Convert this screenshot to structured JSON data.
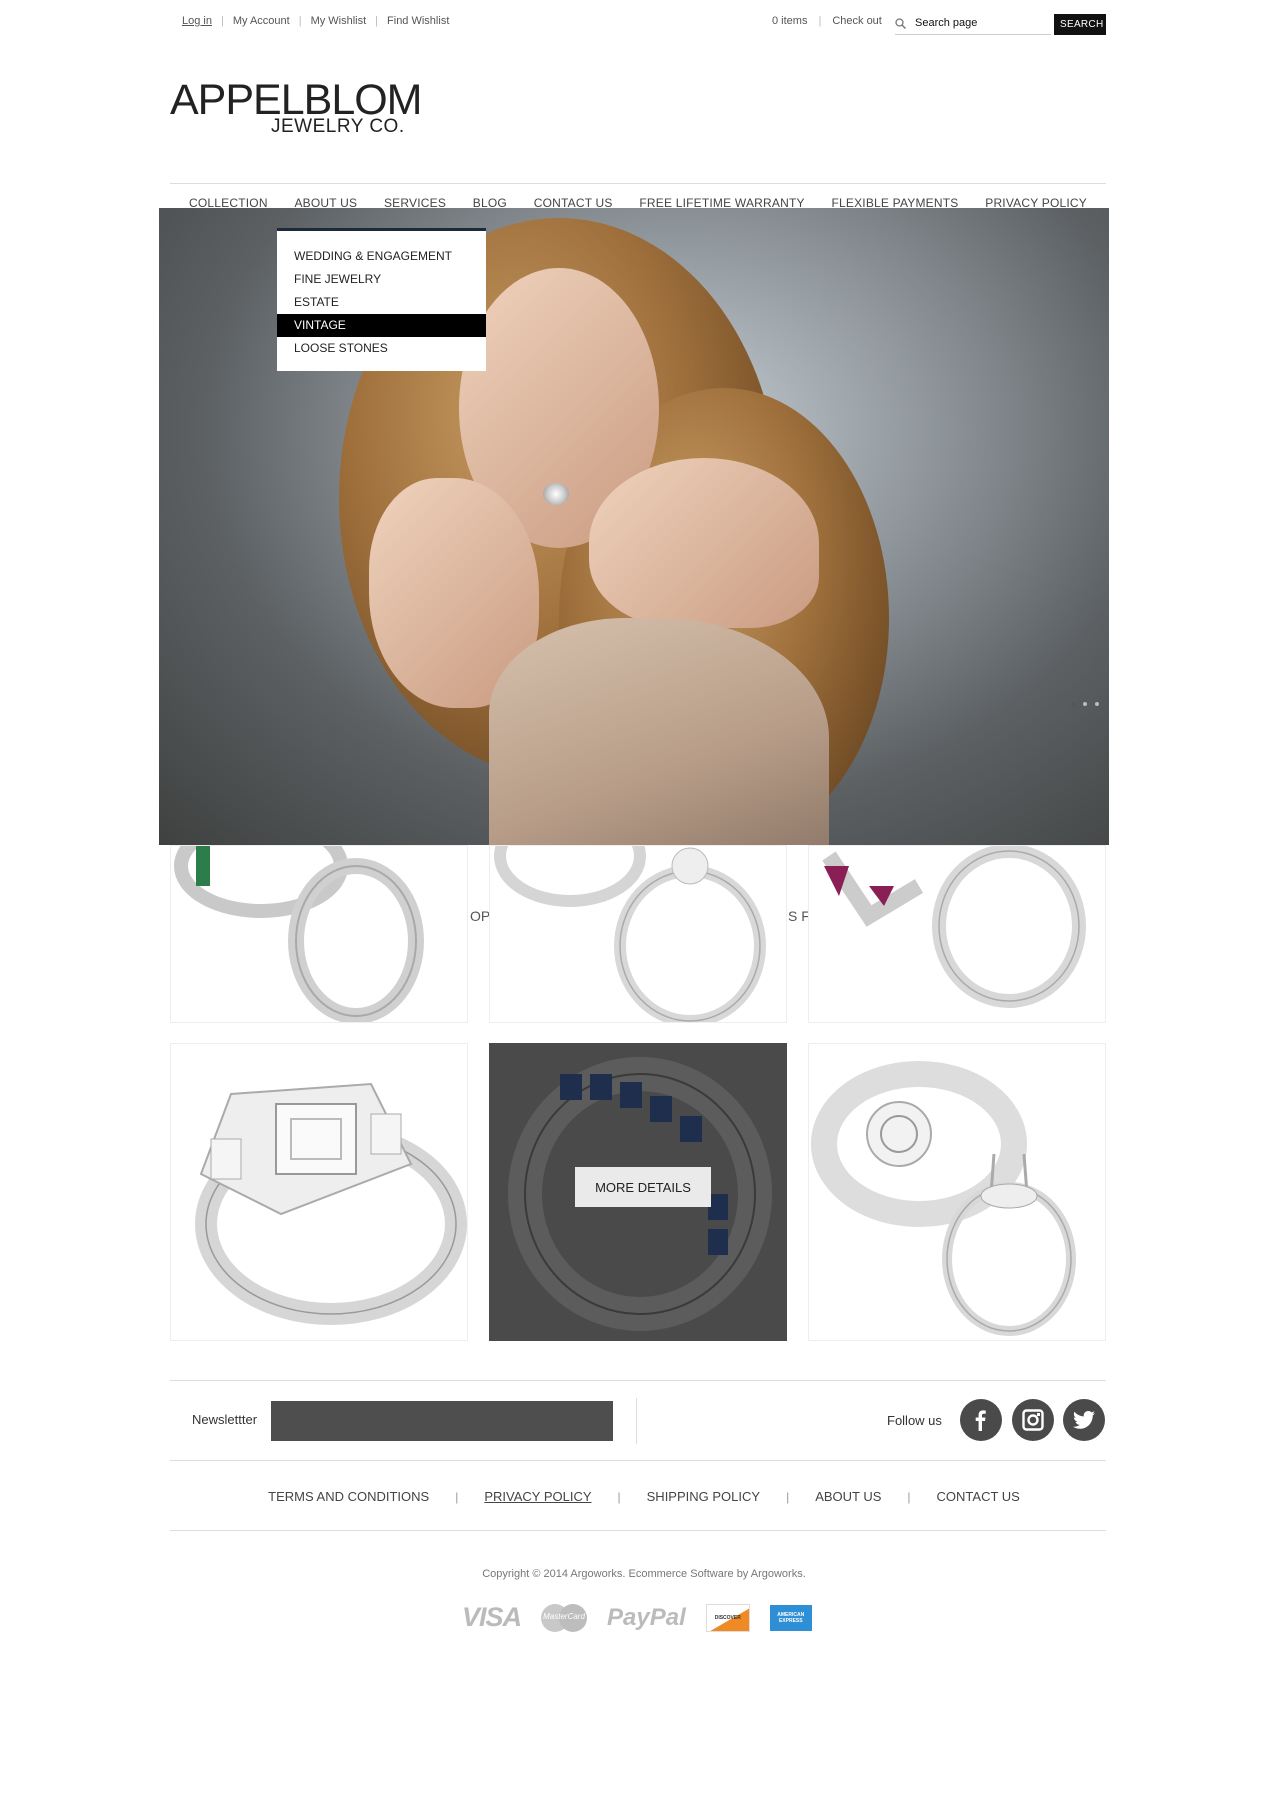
{
  "topbar": {
    "links": [
      "Log in",
      "My Account",
      "My Wishlist",
      "Find Wishlist"
    ],
    "cart_count": "0 items",
    "checkout": "Check out",
    "search_placeholder": "Search page",
    "search_button": "SEARCH"
  },
  "logo": {
    "line1": "APPELBLOM",
    "line2": "JEWELRY CO."
  },
  "nav": {
    "items": [
      "COLLECTION",
      "ABOUT US",
      "SERVICES",
      "BLOG",
      "CONTACT US",
      "FREE LIFETIME WARRANTY",
      "FLEXIBLE PAYMENTS",
      "PRIVACY POLICY"
    ]
  },
  "dropdown": {
    "items": [
      "WEDDING & ENGAGEMENT",
      "FINE JEWELRY",
      "ESTATE",
      "VINTAGE",
      "LOOSE STONES"
    ],
    "active": "VINTAGE"
  },
  "products": {
    "behind_text_1": "OP",
    "behind_text_2": "S F",
    "more_details": "MORE DETAILS"
  },
  "newsletter": {
    "label": "Newslettter"
  },
  "social": {
    "label": "Follow us",
    "icons": [
      "facebook-icon",
      "instagram-icon",
      "twitter-icon"
    ]
  },
  "footer": {
    "links": [
      "TERMS AND CONDITIONS",
      "PRIVACY POLICY",
      "SHIPPING POLICY",
      "ABOUT US",
      "CONTACT US"
    ],
    "copyright": "Copyright © 2014  Argoworks.   Ecommerce Software by Argoworks.",
    "payments": [
      "VISA",
      "MasterCard",
      "PayPal",
      "DISCOVER",
      "AMERICAN EXPRESS"
    ]
  },
  "colors": {
    "accent": "#000000",
    "dark_panel": "#4a4a4a",
    "dropdown_top": "#1d2a3a"
  }
}
